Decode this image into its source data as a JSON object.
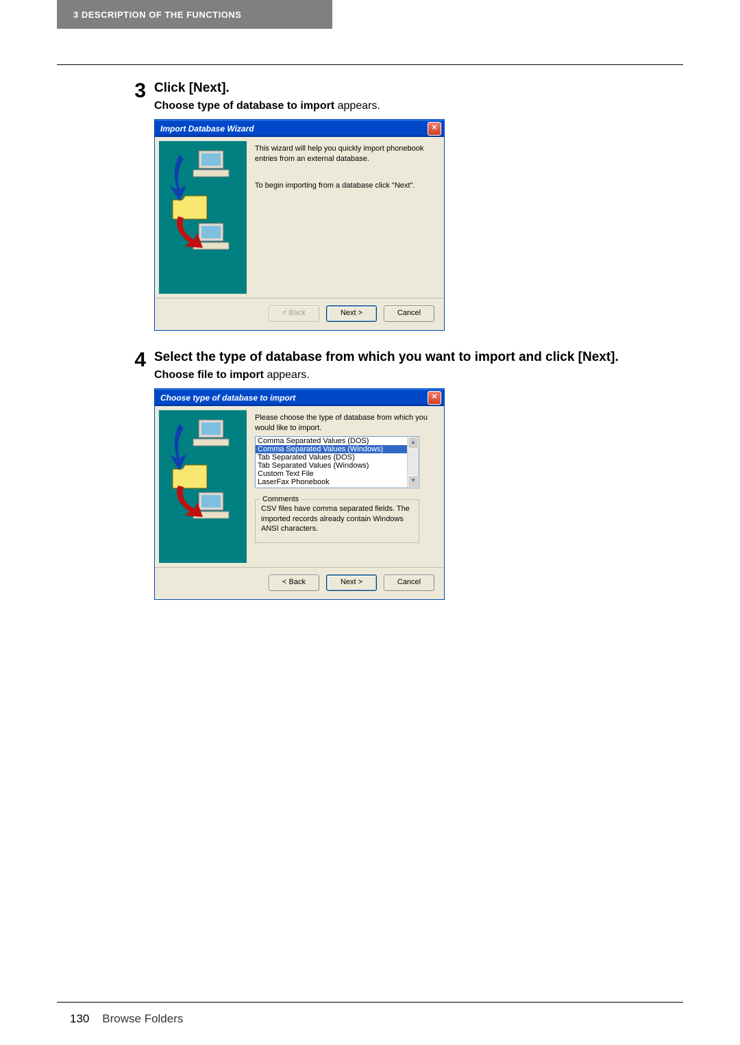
{
  "header": {
    "section_label": "3   DESCRIPTION OF THE FUNCTIONS"
  },
  "step3": {
    "number": "3",
    "title": "Click [Next].",
    "sub_bold": "Choose type of database to import",
    "sub_text": " appears."
  },
  "dialog1": {
    "title": "Import Database Wizard",
    "close": "×",
    "p1": "This wizard will help you quickly import phonebook entries from an external database.",
    "p2": "To begin importing from a database click \"Next\".",
    "back": "< Back",
    "next": "Next >",
    "cancel": "Cancel"
  },
  "step4": {
    "number": "4",
    "title": "Select the type of database from which you want to import and click [Next].",
    "sub_bold": "Choose file to import",
    "sub_text": " appears."
  },
  "dialog2": {
    "title": "Choose type of database to import",
    "close": "×",
    "instruction": "Please choose the type of database from which you would like to import.",
    "list": [
      "Comma Separated Values (DOS)",
      "Comma Separated Values (Windows)",
      "Tab Separated Values (DOS)",
      "Tab Separated Values (Windows)",
      "Custom Text File",
      "LaserFax Phonebook"
    ],
    "selected_index": 1,
    "comments_label": "Comments",
    "comments_text": "CSV files have comma separated fields. The imported records already contain Windows ANSI characters.",
    "back": "< Back",
    "next": "Next >",
    "cancel": "Cancel"
  },
  "footer": {
    "page_number": "130",
    "section": "Browse Folders"
  }
}
